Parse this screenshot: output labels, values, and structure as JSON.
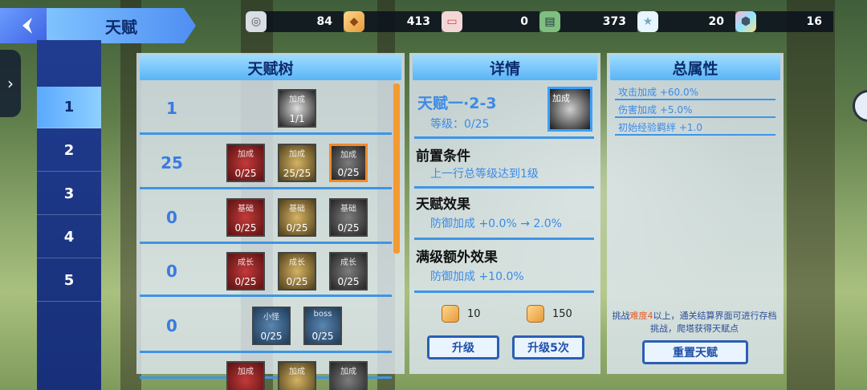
{
  "header": {
    "title": "天赋"
  },
  "resources": [
    {
      "icon": "gear-coin-icon",
      "value": "84"
    },
    {
      "icon": "bread-icon",
      "value": "413"
    },
    {
      "icon": "ticket-icon",
      "value": "0"
    },
    {
      "icon": "book-icon",
      "value": "373"
    },
    {
      "icon": "star-icon",
      "value": "20"
    },
    {
      "icon": "shield-gem-icon",
      "value": "16"
    }
  ],
  "side_tabs": [
    "1",
    "2",
    "3",
    "4",
    "5"
  ],
  "tree": {
    "title": "天赋树",
    "rows": [
      {
        "level": "1",
        "nodes": [
          {
            "label": "加成",
            "count": "1/1",
            "style": "white"
          }
        ]
      },
      {
        "level": "25",
        "nodes": [
          {
            "label": "加成",
            "count": "0/25",
            "style": "red"
          },
          {
            "label": "加成",
            "count": "25/25",
            "style": "gold"
          },
          {
            "label": "加成",
            "count": "0/25",
            "style": "gray",
            "selected": true
          }
        ]
      },
      {
        "level": "0",
        "nodes": [
          {
            "label": "基础",
            "count": "0/25",
            "style": "red"
          },
          {
            "label": "基础",
            "count": "0/25",
            "style": "gold"
          },
          {
            "label": "基础",
            "count": "0/25",
            "style": "gray"
          }
        ]
      },
      {
        "level": "0",
        "nodes": [
          {
            "label": "成长",
            "count": "0/25",
            "style": "red"
          },
          {
            "label": "成长",
            "count": "0/25",
            "style": "gold"
          },
          {
            "label": "成长",
            "count": "0/25",
            "style": "gray"
          }
        ]
      },
      {
        "level": "0",
        "nodes": [
          {
            "label": "小怪",
            "count": "0/25",
            "style": "blue"
          },
          {
            "label": "boss",
            "count": "0/25",
            "style": "blue"
          }
        ]
      },
      {
        "level": "",
        "nodes": [
          {
            "label": "加成",
            "count": "",
            "style": "red"
          },
          {
            "label": "加成",
            "count": "",
            "style": "gold"
          },
          {
            "label": "加成",
            "count": "",
            "style": "gray"
          }
        ]
      }
    ]
  },
  "detail": {
    "title": "详情",
    "talent_name": "天赋一·2-3",
    "level": "等级：0/25",
    "icon_label": "加成",
    "prereq_heading": "前置条件",
    "prereq_text": "上一行总等级达到1级",
    "effect_heading": "天赋效果",
    "effect_text": "防御加成 +0.0% → 2.0%",
    "max_heading": "满级额外效果",
    "max_text": "防御加成 +10.0%",
    "cost1": "10",
    "cost2": "150",
    "upgrade_label": "升级",
    "upgrade5_label": "升级5次"
  },
  "attributes": {
    "title": "总属性",
    "items": [
      "攻击加成 +60.0%",
      "伤害加成 +5.0%",
      "初始经验羁绊 +1.0"
    ],
    "tip_pre": "挑战",
    "tip_highlight": "难度4",
    "tip_post": "以上，通关结算界面可进行存档挑战，爬塔获得天赋点",
    "reset_label": "重置天赋"
  },
  "colors": {
    "accent": "#3b8ae8",
    "selected": "#f08a2a",
    "tab_bg": "#203c8f"
  }
}
